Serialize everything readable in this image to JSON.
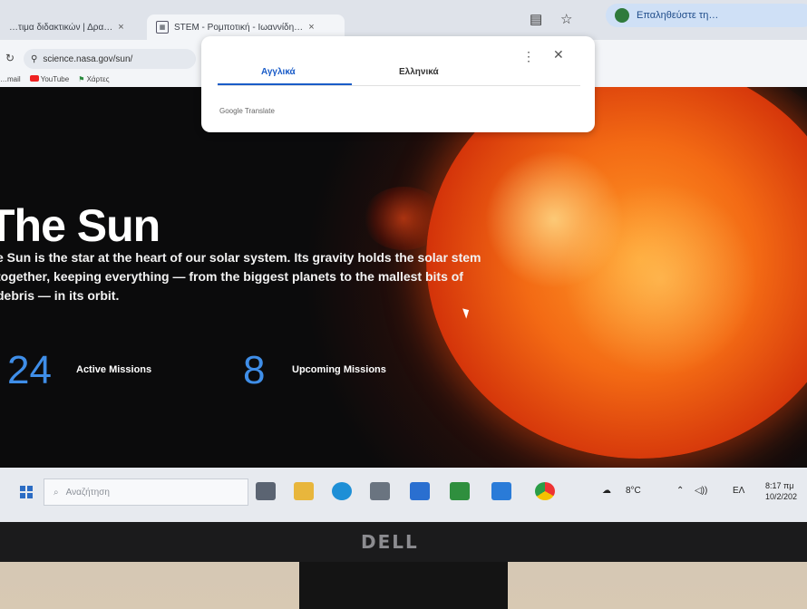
{
  "browser": {
    "tabs": [
      {
        "label": "…τιμα διδακτικών | Δρα…",
        "close": "×"
      },
      {
        "label": "STEM - Ρομποτική - Ιωαννίδη…",
        "close": "×"
      }
    ],
    "extension_pill": "Επαληθεύστε τη…",
    "url": "science.nasa.gov/sun/",
    "bookmarks": [
      "…mail",
      "YouTube",
      "Χάρτες"
    ]
  },
  "translate_popup": {
    "lang_source": "Αγγλικά",
    "lang_target": "Ελληνικά",
    "footer": "Google Translate",
    "more": "⋮",
    "close": "✕"
  },
  "page": {
    "title": "The Sun",
    "description": "e Sun is the star at the heart of our solar system. Its gravity holds the solar stem together, keeping everything — from the biggest planets to the mallest bits of debris — in its orbit.",
    "stats": [
      {
        "number": "24",
        "label": "Active Missions"
      },
      {
        "number": "8",
        "label": "Upcoming Missions"
      }
    ]
  },
  "taskbar": {
    "search_placeholder": "Αναζήτηση",
    "weather": "8°C",
    "language": "ΕΛ",
    "time": "8:17 πμ",
    "date": "10/2/202"
  },
  "monitor": {
    "brand": "DELL"
  },
  "colors": {
    "accent_blue": "#3f8ee8",
    "translate_blue": "#1a5cc8"
  }
}
